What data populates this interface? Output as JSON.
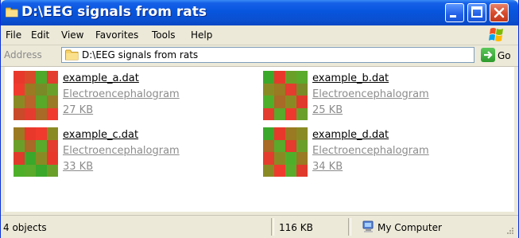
{
  "window": {
    "title": "D:\\EEG signals from rats"
  },
  "menu": [
    "File",
    "Edit",
    "View",
    "Favorites",
    "Tools",
    "Help"
  ],
  "address": {
    "label": "Address",
    "value": "D:\\EEG signals from rats",
    "go_label": "Go"
  },
  "files": [
    {
      "name": "example_a.dat",
      "type": "Electroencephalogram",
      "size": "27 KB"
    },
    {
      "name": "example_b.dat",
      "type": "Electroencephalogram",
      "size": "25 KB"
    },
    {
      "name": "example_c.dat",
      "type": "Electroencephalogram",
      "size": "33 KB"
    },
    {
      "name": "example_d.dat",
      "type": "Electroencephalogram",
      "size": "34 KB"
    }
  ],
  "status": {
    "objects": "4 objects",
    "total_size": "116 KB",
    "location": "My Computer"
  },
  "colors": {
    "titlebar": "#0855dd",
    "chrome": "#ece9d8",
    "link_gray": "#8c8c8c"
  },
  "icons": [
    "folder-icon",
    "minimize-icon",
    "maximize-icon",
    "close-icon",
    "windows-logo-icon",
    "dropdown-arrow-icon",
    "go-arrow-icon",
    "my-computer-icon",
    "file-thumbnail-icon",
    "resize-grip-icon"
  ]
}
